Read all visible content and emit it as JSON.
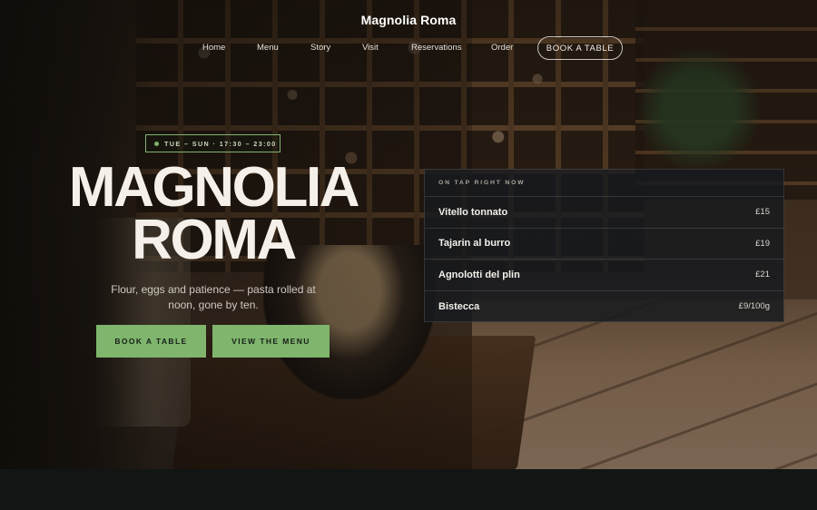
{
  "header": {
    "brand": "Magnolia Roma",
    "nav": [
      {
        "label": "Home"
      },
      {
        "label": "Menu"
      },
      {
        "label": "Story"
      },
      {
        "label": "Visit"
      },
      {
        "label": "Reservations"
      },
      {
        "label": "Order"
      }
    ],
    "cta_label": "BOOK A TABLE"
  },
  "hero": {
    "hours_badge": "TUE – SUN · 17:30 – 23:00",
    "headline_line1": "MAGNOLIA",
    "headline_line2": "ROMA",
    "tagline": "Flour, eggs and patience — pasta rolled at noon, gone by ten.",
    "primary_button": "BOOK A TABLE",
    "secondary_button": "VIEW THE MENU"
  },
  "on_tap": {
    "heading": "ON TAP RIGHT NOW",
    "items": [
      {
        "name": "Vitello tonnato",
        "price": "£15"
      },
      {
        "name": "Tajarin al burro",
        "price": "£19"
      },
      {
        "name": "Agnolotti del plin",
        "price": "£21"
      },
      {
        "name": "Bistecca",
        "price": "£9/100g"
      }
    ]
  },
  "colors": {
    "accent": "#7fb56c",
    "panel": "#161a1e",
    "band": "#111615",
    "headline": "#f5f1ea"
  },
  "icons": {
    "hours_dot": "status-dot-icon"
  }
}
